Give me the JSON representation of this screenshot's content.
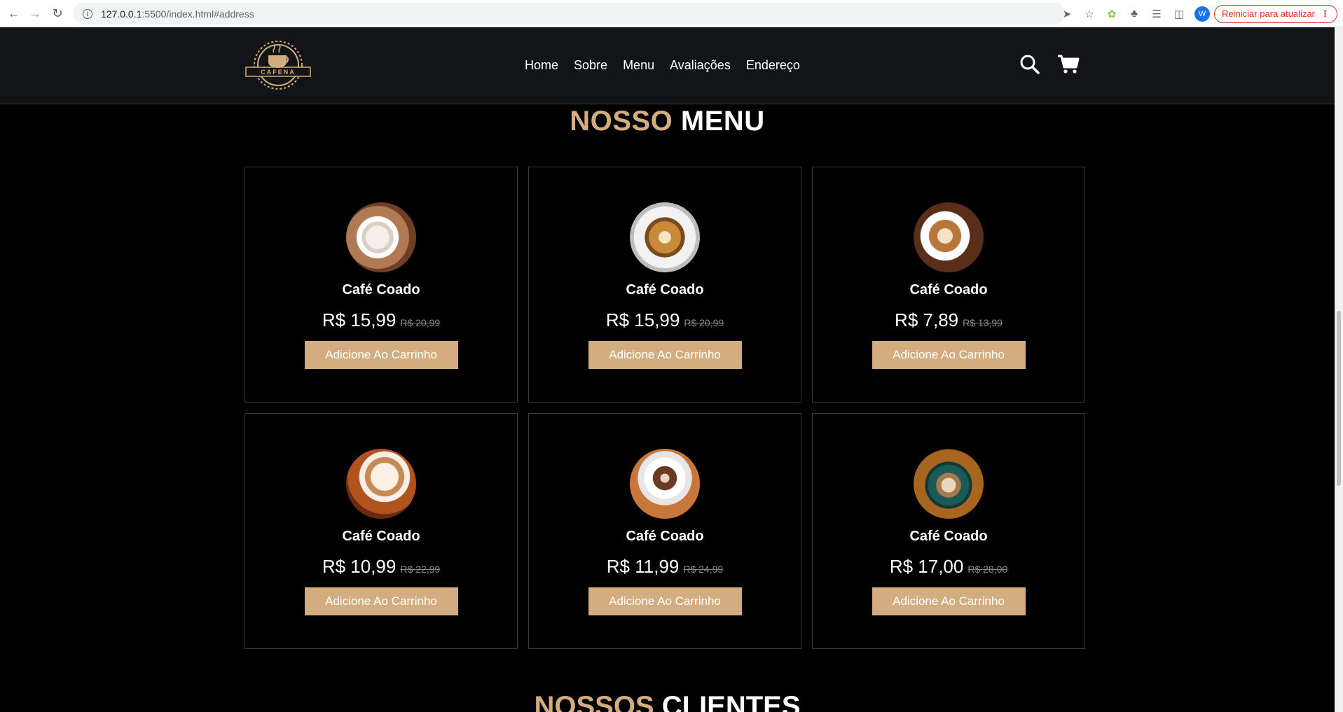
{
  "browser": {
    "url_host": "127.0.0.1",
    "url_path": ":5500/index.html#address",
    "avatar_letter": "W",
    "update_label": "Reiniciar para atualizar"
  },
  "site": {
    "logo_text": "CAFENA",
    "nav": [
      "Home",
      "Sobre",
      "Menu",
      "Avaliações",
      "Endereço"
    ]
  },
  "menu_section": {
    "title_accent": "NOSSO",
    "title_rest": "MENU",
    "items": [
      {
        "name": "Café Coado",
        "price": "R$ 15,99",
        "old_price": "R$ 20,99",
        "button": "Adicione Ao Carrinho"
      },
      {
        "name": "Café Coado",
        "price": "R$ 15,99",
        "old_price": "R$ 20,99",
        "button": "Adicione Ao Carrinho"
      },
      {
        "name": "Café Coado",
        "price": "R$ 7,89",
        "old_price": "R$ 13,99",
        "button": "Adicione Ao Carrinho"
      },
      {
        "name": "Café Coado",
        "price": "R$ 10,99",
        "old_price": "R$ 22,99",
        "button": "Adicione Ao Carrinho"
      },
      {
        "name": "Café Coado",
        "price": "R$ 11,99",
        "old_price": "R$ 24,99",
        "button": "Adicione Ao Carrinho"
      },
      {
        "name": "Café Coado",
        "price": "R$ 17,00",
        "old_price": "R$ 28,00",
        "button": "Adicione Ao Carrinho"
      }
    ]
  },
  "clients_section": {
    "title_accent": "NOSSOS",
    "title_rest": "CLIENTES"
  },
  "colors": {
    "accent": "#d3ad7f",
    "header_bg": "#131417",
    "page_bg": "#000000"
  }
}
